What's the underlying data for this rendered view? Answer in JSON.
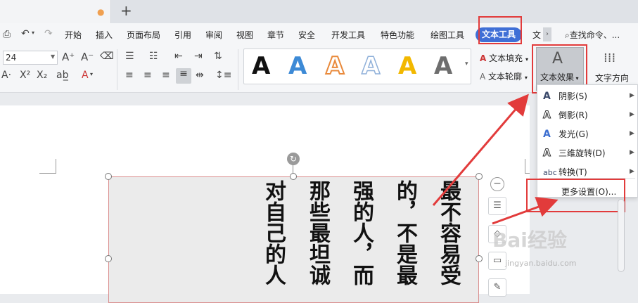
{
  "tabbar": {
    "new_tab": "+",
    "dot": "●"
  },
  "menubar": {
    "items": [
      "开始",
      "插入",
      "页面布局",
      "引用",
      "审阅",
      "视图",
      "章节",
      "安全",
      "开发工具",
      "特色功能",
      "绘图工具"
    ],
    "active": "文本工具",
    "overflow": "文",
    "search": "查找命令、..."
  },
  "ribbon": {
    "font_size": "24",
    "style_glyph": "A",
    "styles_colors": [
      "#111111",
      "#3d8ad6",
      "#e98a3c",
      "#8fb0d9",
      "#f2b800",
      "#6e6e6e"
    ],
    "fill_label": "文本填充",
    "outline_label": "文本轮廓",
    "effect_icon": "A",
    "effect_label": "文本效果",
    "direction_label": "文字方向"
  },
  "document": {
    "columns": [
      "最不容易受",
      "的，不是最",
      "强的人，而",
      "那些最坦诚",
      "对自己的人"
    ]
  },
  "dropdown": {
    "items": [
      {
        "icon": "A",
        "label": "阴影(S)"
      },
      {
        "icon": "A",
        "label": "倒影(R)"
      },
      {
        "icon": "A",
        "label": "发光(G)"
      },
      {
        "icon": "A",
        "label": "三维旋转(D)"
      },
      {
        "icon": "abc",
        "label": "转换(T)"
      }
    ],
    "more": "更多设置(O)..."
  },
  "watermark": {
    "text": "Bai经验",
    "url": "jingyan.baidu.com"
  },
  "colors": {
    "accent": "#3f6fd6",
    "highlight": "#e23b3b"
  }
}
